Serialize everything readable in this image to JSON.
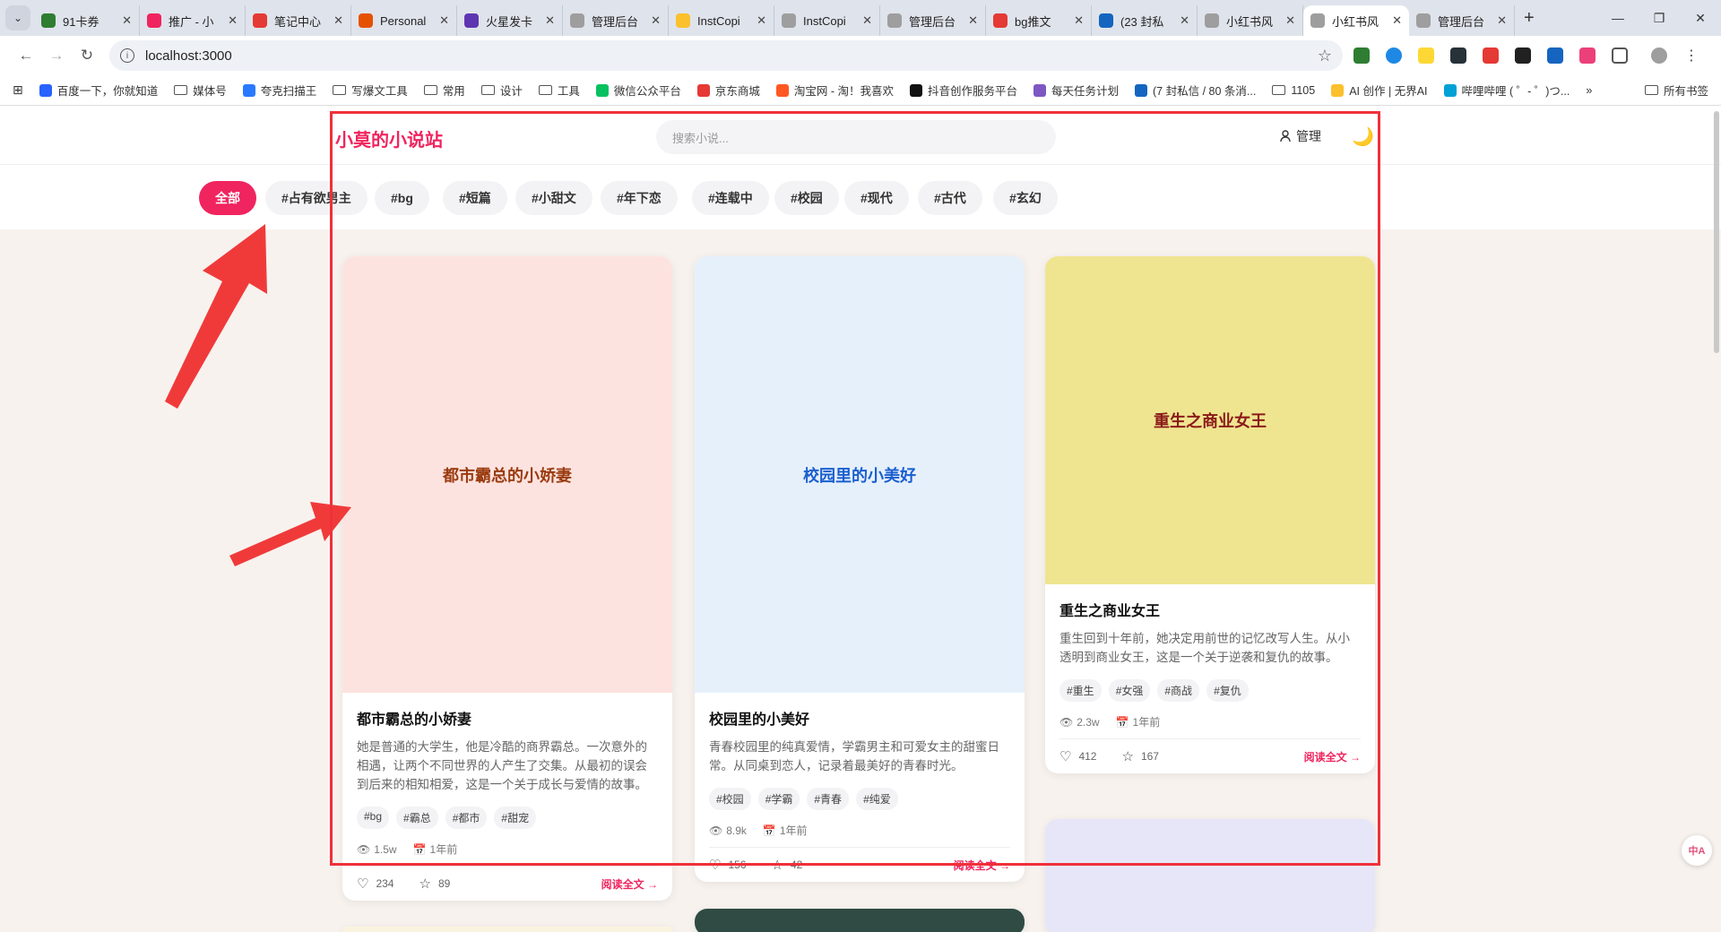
{
  "browser": {
    "tabs": [
      {
        "title": "91卡券",
        "color": "#2e7d32"
      },
      {
        "title": "推广 - 小",
        "color": "#f0245e"
      },
      {
        "title": "笔记中心",
        "color": "#e53935"
      },
      {
        "title": "Personal",
        "color": "#e65100"
      },
      {
        "title": "火星发卡",
        "color": "#5e35b1"
      },
      {
        "title": "管理后台",
        "color": "#9e9e9e"
      },
      {
        "title": "InstCopi",
        "color": "#fbc02d"
      },
      {
        "title": "InstCopi",
        "color": "#9e9e9e"
      },
      {
        "title": "管理后台",
        "color": "#9e9e9e"
      },
      {
        "title": "bg推文",
        "color": "#e53935"
      },
      {
        "title": "(23 封私",
        "color": "#1565c0"
      },
      {
        "title": "小红书风",
        "color": "#9e9e9e"
      },
      {
        "title": "小红书风",
        "color": "#9e9e9e",
        "active": true
      },
      {
        "title": "管理后台",
        "color": "#9e9e9e"
      }
    ],
    "url": "localhost:3000",
    "bookmarks": [
      {
        "label": "百度一下，你就知道",
        "kind": "icon",
        "color": "#2962ff"
      },
      {
        "label": "媒体号",
        "kind": "folder"
      },
      {
        "label": "夸克扫描王",
        "kind": "icon",
        "color": "#2979ff"
      },
      {
        "label": "写爆文工具",
        "kind": "folder"
      },
      {
        "label": "常用",
        "kind": "folder"
      },
      {
        "label": "设计",
        "kind": "folder"
      },
      {
        "label": "工具",
        "kind": "folder"
      },
      {
        "label": "微信公众平台",
        "kind": "icon",
        "color": "#07c160"
      },
      {
        "label": "京东商城",
        "kind": "icon",
        "color": "#e53935"
      },
      {
        "label": "淘宝网 - 淘！我喜欢",
        "kind": "icon",
        "color": "#ff5722"
      },
      {
        "label": "抖音创作服务平台",
        "kind": "icon",
        "color": "#111111"
      },
      {
        "label": "每天任务计划",
        "kind": "icon",
        "color": "#7e57c2"
      },
      {
        "label": "(7 封私信 / 80 条消...",
        "kind": "icon",
        "color": "#1565c0"
      },
      {
        "label": "1105",
        "kind": "folder"
      },
      {
        "label": "AI 创作 | 无界AI",
        "kind": "icon",
        "color": "#fbc02d"
      },
      {
        "label": "哔哩哔哩 ( ゜- ゜)つ...",
        "kind": "icon",
        "color": "#00a1d6"
      }
    ],
    "bookmarks_more": "»",
    "all_bookmarks": "所有书签"
  },
  "site": {
    "logo": "小莫的小说站",
    "search_placeholder": "搜索小说...",
    "admin_label": "管理",
    "theme_icon": "🌙",
    "categories": [
      "全部",
      "#占有欲男主",
      "#bg",
      "#短篇",
      "#小甜文",
      "#年下恋",
      "#连载中",
      "#校园",
      "#现代",
      "#古代",
      "#玄幻"
    ],
    "active_category": "全部",
    "novels": [
      {
        "cover_title": "都市霸总的小娇妻",
        "cover_bg": "#fde3df",
        "cover_color": "#9a3b10",
        "title": "都市霸总的小娇妻",
        "desc": "她是普通的大学生，他是冷酷的商界霸总。一次意外的相遇，让两个不同世界的人产生了交集。从最初的误会到后来的相知相爱，这是一个关于成长与爱情的故事。",
        "tags": [
          "#bg",
          "#霸总",
          "#都市",
          "#甜宠"
        ],
        "views": "1.5w",
        "time": "1年前",
        "likes": "234",
        "stars": "89",
        "read": "阅读全文 →"
      },
      {
        "cover_title": "校园里的小美好",
        "cover_bg": "#e6f0fb",
        "cover_color": "#1a5fcf",
        "title": "校园里的小美好",
        "desc": "青春校园里的纯真爱情，学霸男主和可爱女主的甜蜜日常。从同桌到恋人，记录着最美好的青春时光。",
        "tags": [
          "#校园",
          "#学霸",
          "#青春",
          "#纯爱"
        ],
        "views": "8.9k",
        "time": "1年前",
        "likes": "156",
        "stars": "42",
        "read": "阅读全文 →"
      },
      {
        "cover_title": "重生之商业女王",
        "cover_bg": "#efe590",
        "cover_color": "#8b1a1a",
        "title": "重生之商业女王",
        "desc": "重生回到十年前，她决定用前世的记忆改写人生。从小透明到商业女王，这是一个关于逆袭和复仇的故事。",
        "tags": [
          "#重生",
          "#女强",
          "#商战",
          "#复仇"
        ],
        "views": "2.3w",
        "time": "1年前",
        "likes": "412",
        "stars": "167",
        "read": "阅读全文 →"
      }
    ],
    "more_covers": [
      "#2f4b44",
      "#e7e6f8",
      "#faf3e0"
    ]
  }
}
